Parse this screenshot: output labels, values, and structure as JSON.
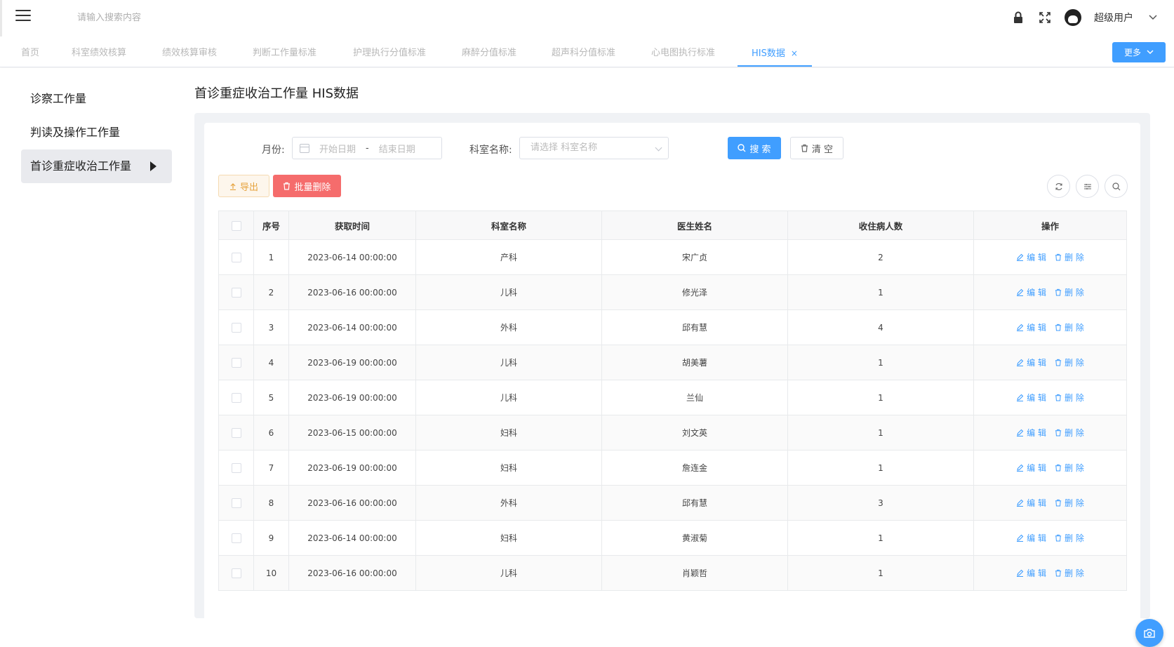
{
  "topbar": {
    "search_placeholder": "请输入搜索内容",
    "username": "超级用户"
  },
  "tabs": [
    {
      "label": "首页"
    },
    {
      "label": "科室绩效核算"
    },
    {
      "label": "绩效核算审核"
    },
    {
      "label": "判断工作量标准"
    },
    {
      "label": "护理执行分值标准"
    },
    {
      "label": "麻醉分值标准"
    },
    {
      "label": "超声科分值标准"
    },
    {
      "label": "心电图执行标准"
    },
    {
      "label": "HIS数据",
      "active": true,
      "close": "×"
    }
  ],
  "more_button": "更多",
  "sidemenu": [
    {
      "label": "诊察工作量"
    },
    {
      "label": "判读及操作工作量"
    },
    {
      "label": "首诊重症收治工作量",
      "active": true
    }
  ],
  "page_title": "首诊重症收治工作量 HIS数据",
  "filters": {
    "month_label": "月份:",
    "start_placeholder": "开始日期",
    "separator": "-",
    "end_placeholder": "结束日期",
    "dept_label": "科室名称:",
    "dept_placeholder": "请选择 科室名称",
    "search_button": "搜 索",
    "clear_button": "清 空"
  },
  "actions": {
    "export_button": "导出",
    "batch_delete_button": "批量删除"
  },
  "table": {
    "headers": [
      "序号",
      "获取时间",
      "科室名称",
      "医生姓名",
      "收住病人数",
      "操作"
    ],
    "edit_label": "编 辑",
    "delete_label": "删 除",
    "rows": [
      {
        "no": "1",
        "time": "2023-06-14 00:00:00",
        "dept": "产科",
        "doctor": "宋广贞",
        "count": "2"
      },
      {
        "no": "2",
        "time": "2023-06-16 00:00:00",
        "dept": "儿科",
        "doctor": "修光泽",
        "count": "1"
      },
      {
        "no": "3",
        "time": "2023-06-14 00:00:00",
        "dept": "外科",
        "doctor": "邱有慧",
        "count": "4"
      },
      {
        "no": "4",
        "time": "2023-06-19 00:00:00",
        "dept": "儿科",
        "doctor": "胡美薯",
        "count": "1"
      },
      {
        "no": "5",
        "time": "2023-06-19 00:00:00",
        "dept": "儿科",
        "doctor": "兰仙",
        "count": "1"
      },
      {
        "no": "6",
        "time": "2023-06-15 00:00:00",
        "dept": "妇科",
        "doctor": "刘文英",
        "count": "1"
      },
      {
        "no": "7",
        "time": "2023-06-19 00:00:00",
        "dept": "妇科",
        "doctor": "詹连金",
        "count": "1"
      },
      {
        "no": "8",
        "time": "2023-06-16 00:00:00",
        "dept": "外科",
        "doctor": "邱有慧",
        "count": "3"
      },
      {
        "no": "9",
        "time": "2023-06-14 00:00:00",
        "dept": "妇科",
        "doctor": "黄淑菊",
        "count": "1"
      },
      {
        "no": "10",
        "time": "2023-06-16 00:00:00",
        "dept": "儿科",
        "doctor": "肖颖哲",
        "count": "1"
      }
    ]
  }
}
